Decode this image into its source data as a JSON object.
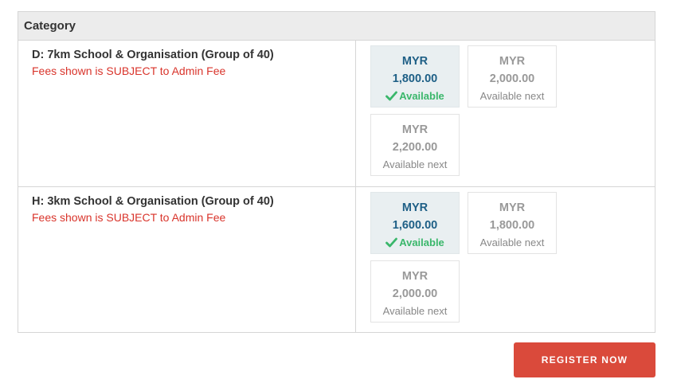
{
  "table": {
    "header": "Category",
    "rows": [
      {
        "name": "D: 7km School & Organisation (Group of 40)",
        "note": "Fees shown is SUBJECT to Admin Fee",
        "prices": [
          {
            "currency": "MYR",
            "amount": "1,800.00",
            "status": "Available",
            "state": "available"
          },
          {
            "currency": "MYR",
            "amount": "2,000.00",
            "status": "Available next",
            "state": "upcoming"
          },
          {
            "currency": "MYR",
            "amount": "2,200.00",
            "status": "Available next",
            "state": "upcoming"
          }
        ]
      },
      {
        "name": "H: 3km School & Organisation (Group of 40)",
        "note": "Fees shown is SUBJECT to Admin Fee",
        "prices": [
          {
            "currency": "MYR",
            "amount": "1,600.00",
            "status": "Available",
            "state": "available"
          },
          {
            "currency": "MYR",
            "amount": "1,800.00",
            "status": "Available next",
            "state": "upcoming"
          },
          {
            "currency": "MYR",
            "amount": "2,000.00",
            "status": "Available next",
            "state": "upcoming"
          }
        ]
      }
    ]
  },
  "register_label": "REGISTER NOW",
  "colors": {
    "accent_red": "#da4a3b",
    "note_red": "#d9342b",
    "active_blue": "#1e5f86",
    "available_green": "#3ab76b",
    "active_bg": "#e9eff1"
  },
  "icons": {
    "available": "check-icon"
  }
}
